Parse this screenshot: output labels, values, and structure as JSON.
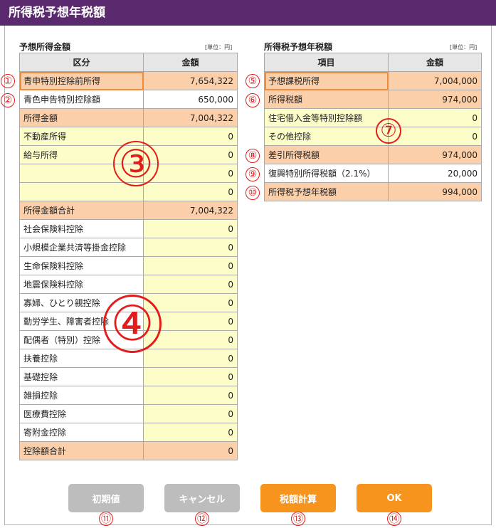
{
  "title": "所得税予想年税額",
  "left": {
    "section_title": "予想所得金額",
    "unit": "[単位：円]",
    "headers": [
      "区分",
      "金額"
    ],
    "rows": [
      {
        "label": "青申特別控除前所得",
        "value": "7,654,322"
      },
      {
        "label": "青色申告特別控除額",
        "value": "650,000"
      },
      {
        "label": "所得金額",
        "value": "7,004,322"
      },
      {
        "label": "不動産所得",
        "value": "0"
      },
      {
        "label": "給与所得",
        "value": "0"
      },
      {
        "label": "",
        "value": "0"
      },
      {
        "label": "",
        "value": "0"
      },
      {
        "label": "所得金額合計",
        "value": "7,004,322"
      },
      {
        "label": "社会保険料控除",
        "value": "0"
      },
      {
        "label": "小規模企業共済等掛金控除",
        "value": "0"
      },
      {
        "label": "生命保険料控除",
        "value": "0"
      },
      {
        "label": "地震保険料控除",
        "value": "0"
      },
      {
        "label": "寡婦、ひとり親控除",
        "value": "0"
      },
      {
        "label": "勤労学生、障害者控除",
        "value": "0"
      },
      {
        "label": "配偶者（特別）控除",
        "value": "0"
      },
      {
        "label": "扶養控除",
        "value": "0"
      },
      {
        "label": "基礎控除",
        "value": "0"
      },
      {
        "label": "雑損控除",
        "value": "0"
      },
      {
        "label": "医療費控除",
        "value": "0"
      },
      {
        "label": "寄附金控除",
        "value": "0"
      },
      {
        "label": "控除額合計",
        "value": "0"
      }
    ]
  },
  "right": {
    "section_title": "所得税予想年税額",
    "unit": "[単位：円]",
    "headers": [
      "項目",
      "金額"
    ],
    "rows": [
      {
        "label": "予想課税所得",
        "value": "7,004,000"
      },
      {
        "label": "所得税額",
        "value": "974,000"
      },
      {
        "label": "住宅借入金等特別控除額",
        "value": "0"
      },
      {
        "label": "その他控除",
        "value": "0"
      },
      {
        "label": "差引所得税額",
        "value": "974,000"
      },
      {
        "label": "復興特別所得税額（2.1%）",
        "value": "20,000"
      },
      {
        "label": "所得税予想年税額",
        "value": "994,000"
      }
    ]
  },
  "markers": [
    "①",
    "②",
    "③",
    "④",
    "⑤",
    "⑥",
    "⑦",
    "⑧",
    "⑨",
    "⑩",
    "⑪",
    "⑫",
    "⑬",
    "⑭"
  ],
  "buttons": {
    "reset": "初期値",
    "cancel": "キャンセル",
    "calc": "税額計算",
    "ok": "OK"
  },
  "colors": {
    "titlebar": "#5b2a6e",
    "orange_cell": "#fbcfa9",
    "yellow_cell": "#fdfdc9",
    "button_orange": "#f7941d",
    "button_gray": "#bdbdbd",
    "marker_red": "#e21b1b"
  }
}
